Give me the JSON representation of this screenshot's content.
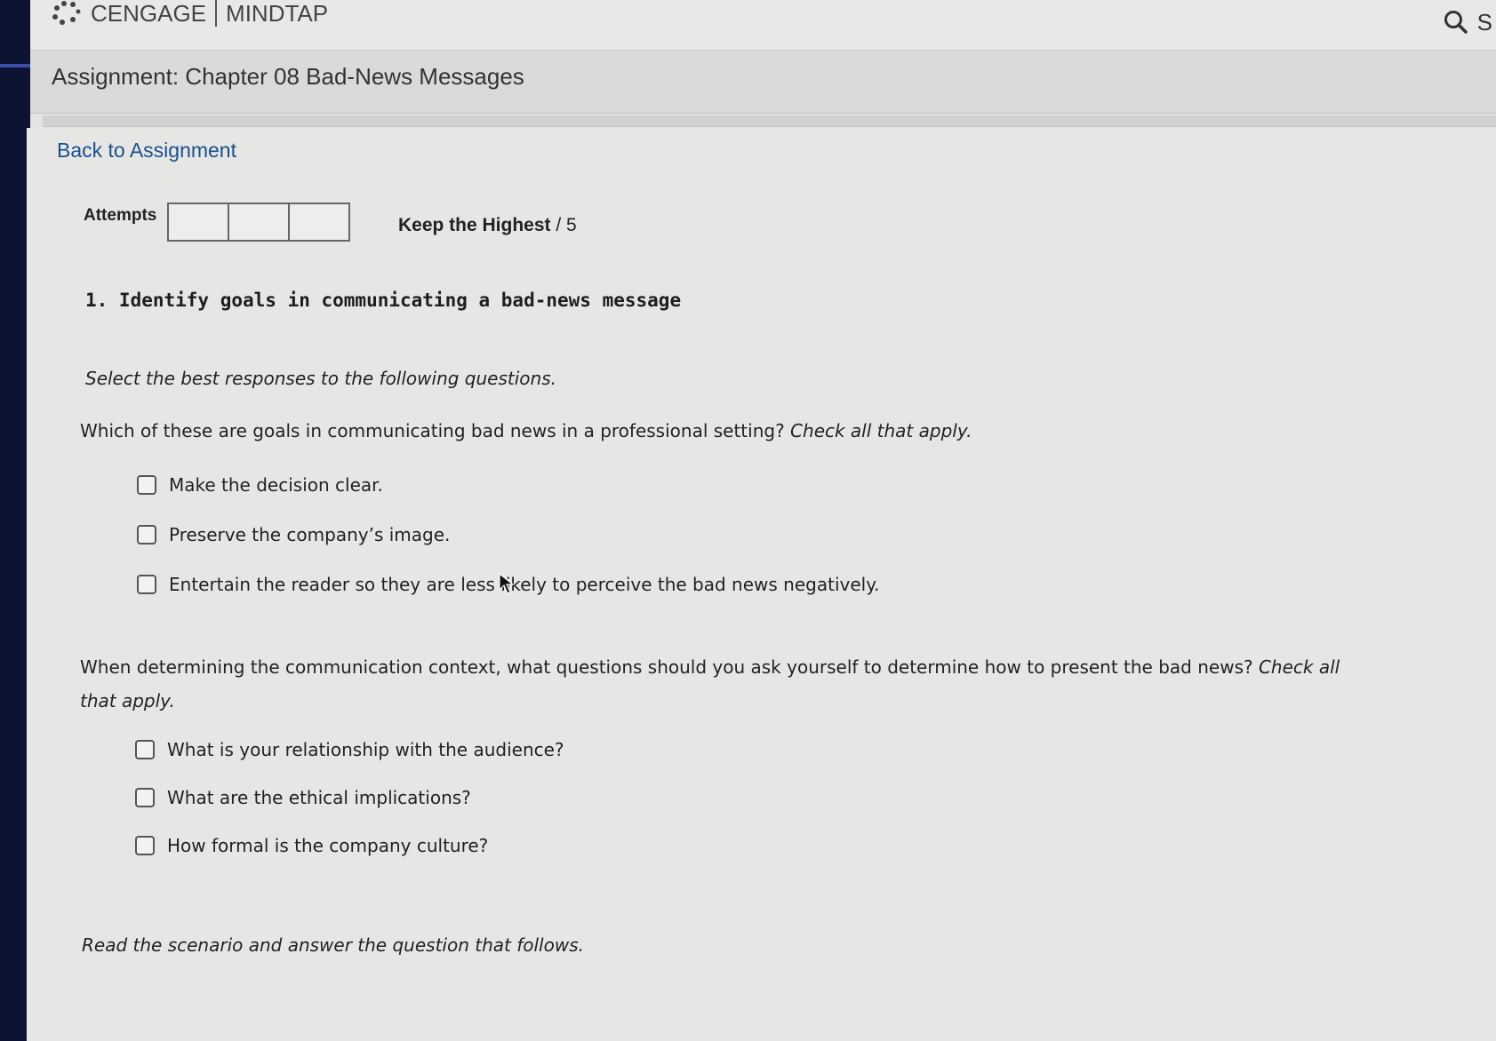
{
  "brand": {
    "name": "CENGAGE",
    "product": "MINDTAP"
  },
  "search": {
    "trailing_letter": "S"
  },
  "header": {
    "title": "Assignment: Chapter 08 Bad-News Messages"
  },
  "nav": {
    "back_link": "Back to Assignment"
  },
  "attempts": {
    "label": "Attempts",
    "boxes": 3
  },
  "grading": {
    "policy": "Keep the Highest",
    "score": "/ 5"
  },
  "question": {
    "heading": "1. Identify goals in communicating a bad-news message",
    "instruction": "Select the best responses to the following questions.",
    "q1": {
      "text": "Which of these are goals in communicating bad news in a professional setting?",
      "hint": "Check all that apply.",
      "options": [
        "Make the decision clear.",
        "Preserve the company’s image.",
        "Entertain the reader so they are less likely to perceive the bad news negatively."
      ]
    },
    "q2": {
      "text": "When determining the communication context, what questions should you ask yourself to determine how to present the bad news?",
      "hint": "Check all that apply.",
      "options": [
        "What is your relationship with the audience?",
        "What are the ethical implications?",
        "How formal is the company culture?"
      ]
    },
    "scenario": "Read the scenario and answer the question that follows."
  }
}
